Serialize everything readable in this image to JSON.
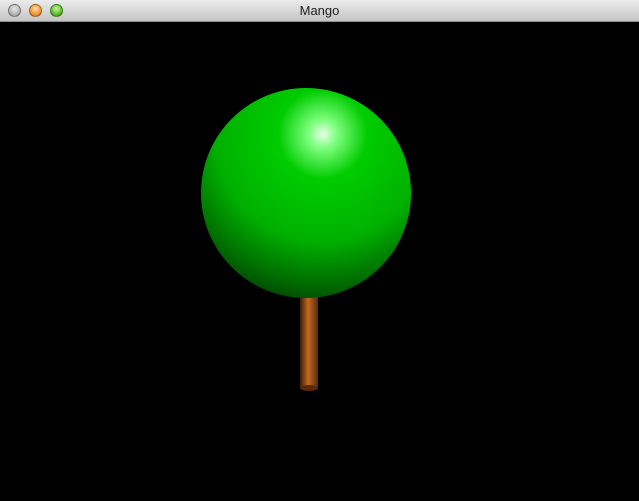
{
  "window": {
    "title": "Mango",
    "controls": {
      "close_icon": "close-icon",
      "minimize_icon": "minimize-icon",
      "zoom_icon": "zoom-icon"
    }
  },
  "scene": {
    "background_color": "#000000",
    "canopy_color": "#00cc00",
    "canopy_highlight_color": "#e8ffe8",
    "canopy_shadow_color": "#004400",
    "trunk_color": "#8b4513",
    "trunk_highlight_color": "#c46a1f",
    "trunk_shadow_color": "#3a1a05"
  }
}
